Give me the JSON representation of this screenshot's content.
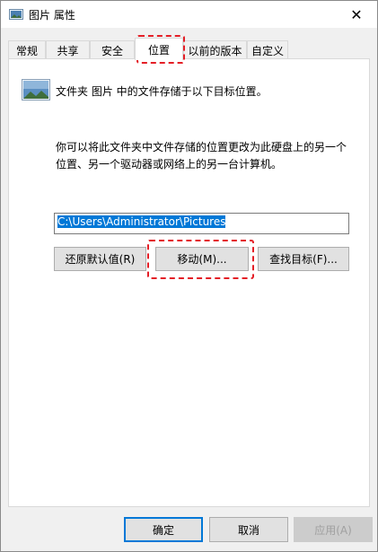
{
  "window": {
    "title": "图片 属性",
    "close_glyph": "✕"
  },
  "tabs": [
    {
      "label": "常规"
    },
    {
      "label": "共享"
    },
    {
      "label": "安全"
    },
    {
      "label": "位置",
      "active": true
    },
    {
      "label": "以前的版本"
    },
    {
      "label": "自定义"
    }
  ],
  "location": {
    "summary": "文件夹 图片 中的文件存储于以下目标位置。",
    "help": "你可以将此文件夹中文件存储的位置更改为此硬盘上的另一个位置、另一个驱动器或网络上的另一台计算机。",
    "path": "C:\\Users\\Administrator\\Pictures",
    "restore_label": "还原默认值(R)",
    "move_label": "移动(M)...",
    "find_label": "查找目标(F)..."
  },
  "footer": {
    "ok_label": "确定",
    "cancel_label": "取消",
    "apply_label": "应用(A)"
  },
  "colors": {
    "highlight": "#e41e26",
    "selection": "#0078d7"
  }
}
